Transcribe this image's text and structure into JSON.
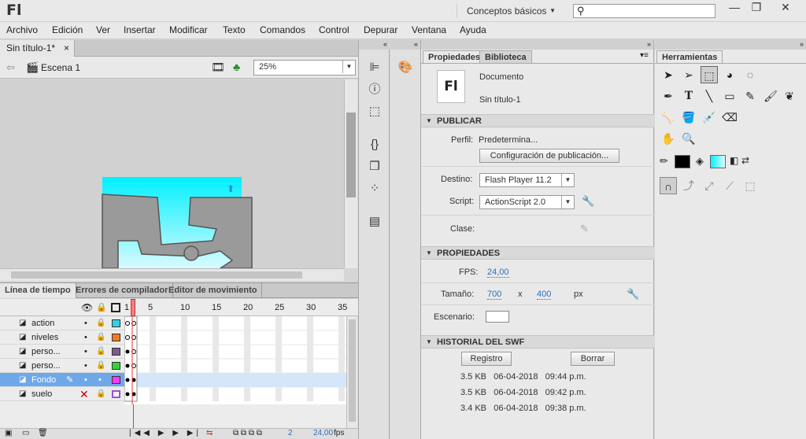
{
  "app": {
    "logo": "Fl",
    "workspace": "Conceptos básicos",
    "search_placeholder": ""
  },
  "menu": [
    "Archivo",
    "Edición",
    "Ver",
    "Insertar",
    "Modificar",
    "Texto",
    "Comandos",
    "Control",
    "Depurar",
    "Ventana",
    "Ayuda"
  ],
  "document": {
    "tab": "Sin título-1*",
    "scene": "Escena 1",
    "zoom": "25%"
  },
  "timeline": {
    "tabs": [
      "Línea de tiempo",
      "Errores de compilador",
      "Editor de movimiento"
    ],
    "ruler": [
      "1",
      "5",
      "10",
      "15",
      "20",
      "25",
      "30",
      "35"
    ],
    "layers": [
      {
        "name": "action",
        "color": "#2ed3e6"
      },
      {
        "name": "niveles",
        "color": "#f07d1f"
      },
      {
        "name": "perso...",
        "color": "#7a5c8a"
      },
      {
        "name": "perso...",
        "color": "#37d037"
      },
      {
        "name": "Fondo",
        "color": "#ff37ff"
      },
      {
        "name": "suelo",
        "color": "#9a4fd0"
      }
    ],
    "current_frame": "2",
    "fps": "24,00",
    "fps_unit": "fps"
  },
  "properties": {
    "tabs": [
      "Propiedades",
      "Biblioteca"
    ],
    "doc_icon": "Fl",
    "doc_type": "Documento",
    "doc_name": "Sin título-1",
    "publish": {
      "header": "PUBLICAR",
      "profile_label": "Perfil:",
      "profile_value": "Predetermina...",
      "config_button": "Configuración de publicación...",
      "target_label": "Destino:",
      "target_value": "Flash Player 11.2",
      "script_label": "Script:",
      "script_value": "ActionScript 2.0",
      "class_label": "Clase:"
    },
    "props": {
      "header": "PROPIEDADES",
      "fps_label": "FPS:",
      "fps_value": "24,00",
      "size_label": "Tamaño:",
      "width": "700",
      "x": "x",
      "height": "400",
      "unit": "px",
      "stage_label": "Escenario:"
    },
    "history": {
      "header": "HISTORIAL DEL SWF",
      "log_button": "Registro",
      "clear_button": "Borrar",
      "entries": [
        {
          "size": "3.5 KB",
          "date": "06-04-2018",
          "time": "09:44 p.m."
        },
        {
          "size": "3.5 KB",
          "date": "06-04-2018",
          "time": "09:42 p.m."
        },
        {
          "size": "3.4 KB",
          "date": "06-04-2018",
          "time": "09:38 p.m."
        }
      ]
    }
  },
  "tools": {
    "tab": "Herramientas"
  }
}
